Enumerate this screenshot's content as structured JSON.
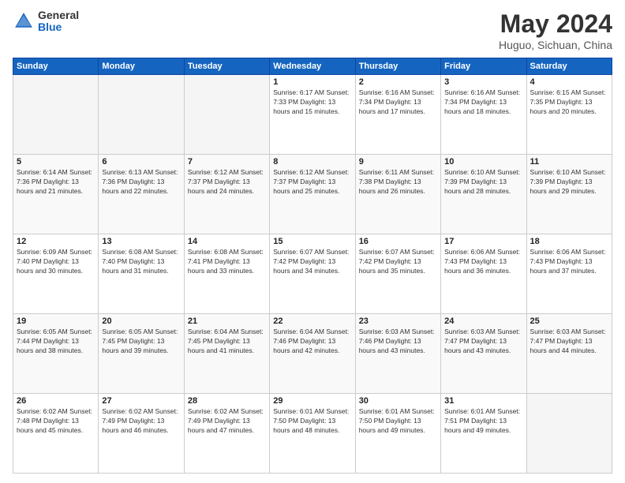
{
  "header": {
    "logo": {
      "general": "General",
      "blue": "Blue"
    },
    "title": "May 2024",
    "location": "Huguo, Sichuan, China"
  },
  "days_of_week": [
    "Sunday",
    "Monday",
    "Tuesday",
    "Wednesday",
    "Thursday",
    "Friday",
    "Saturday"
  ],
  "weeks": [
    [
      {
        "day": "",
        "info": ""
      },
      {
        "day": "",
        "info": ""
      },
      {
        "day": "",
        "info": ""
      },
      {
        "day": "1",
        "info": "Sunrise: 6:17 AM\nSunset: 7:33 PM\nDaylight: 13 hours\nand 15 minutes."
      },
      {
        "day": "2",
        "info": "Sunrise: 6:16 AM\nSunset: 7:34 PM\nDaylight: 13 hours\nand 17 minutes."
      },
      {
        "day": "3",
        "info": "Sunrise: 6:16 AM\nSunset: 7:34 PM\nDaylight: 13 hours\nand 18 minutes."
      },
      {
        "day": "4",
        "info": "Sunrise: 6:15 AM\nSunset: 7:35 PM\nDaylight: 13 hours\nand 20 minutes."
      }
    ],
    [
      {
        "day": "5",
        "info": "Sunrise: 6:14 AM\nSunset: 7:36 PM\nDaylight: 13 hours\nand 21 minutes."
      },
      {
        "day": "6",
        "info": "Sunrise: 6:13 AM\nSunset: 7:36 PM\nDaylight: 13 hours\nand 22 minutes."
      },
      {
        "day": "7",
        "info": "Sunrise: 6:12 AM\nSunset: 7:37 PM\nDaylight: 13 hours\nand 24 minutes."
      },
      {
        "day": "8",
        "info": "Sunrise: 6:12 AM\nSunset: 7:37 PM\nDaylight: 13 hours\nand 25 minutes."
      },
      {
        "day": "9",
        "info": "Sunrise: 6:11 AM\nSunset: 7:38 PM\nDaylight: 13 hours\nand 26 minutes."
      },
      {
        "day": "10",
        "info": "Sunrise: 6:10 AM\nSunset: 7:39 PM\nDaylight: 13 hours\nand 28 minutes."
      },
      {
        "day": "11",
        "info": "Sunrise: 6:10 AM\nSunset: 7:39 PM\nDaylight: 13 hours\nand 29 minutes."
      }
    ],
    [
      {
        "day": "12",
        "info": "Sunrise: 6:09 AM\nSunset: 7:40 PM\nDaylight: 13 hours\nand 30 minutes."
      },
      {
        "day": "13",
        "info": "Sunrise: 6:08 AM\nSunset: 7:40 PM\nDaylight: 13 hours\nand 31 minutes."
      },
      {
        "day": "14",
        "info": "Sunrise: 6:08 AM\nSunset: 7:41 PM\nDaylight: 13 hours\nand 33 minutes."
      },
      {
        "day": "15",
        "info": "Sunrise: 6:07 AM\nSunset: 7:42 PM\nDaylight: 13 hours\nand 34 minutes."
      },
      {
        "day": "16",
        "info": "Sunrise: 6:07 AM\nSunset: 7:42 PM\nDaylight: 13 hours\nand 35 minutes."
      },
      {
        "day": "17",
        "info": "Sunrise: 6:06 AM\nSunset: 7:43 PM\nDaylight: 13 hours\nand 36 minutes."
      },
      {
        "day": "18",
        "info": "Sunrise: 6:06 AM\nSunset: 7:43 PM\nDaylight: 13 hours\nand 37 minutes."
      }
    ],
    [
      {
        "day": "19",
        "info": "Sunrise: 6:05 AM\nSunset: 7:44 PM\nDaylight: 13 hours\nand 38 minutes."
      },
      {
        "day": "20",
        "info": "Sunrise: 6:05 AM\nSunset: 7:45 PM\nDaylight: 13 hours\nand 39 minutes."
      },
      {
        "day": "21",
        "info": "Sunrise: 6:04 AM\nSunset: 7:45 PM\nDaylight: 13 hours\nand 41 minutes."
      },
      {
        "day": "22",
        "info": "Sunrise: 6:04 AM\nSunset: 7:46 PM\nDaylight: 13 hours\nand 42 minutes."
      },
      {
        "day": "23",
        "info": "Sunrise: 6:03 AM\nSunset: 7:46 PM\nDaylight: 13 hours\nand 43 minutes."
      },
      {
        "day": "24",
        "info": "Sunrise: 6:03 AM\nSunset: 7:47 PM\nDaylight: 13 hours\nand 43 minutes."
      },
      {
        "day": "25",
        "info": "Sunrise: 6:03 AM\nSunset: 7:47 PM\nDaylight: 13 hours\nand 44 minutes."
      }
    ],
    [
      {
        "day": "26",
        "info": "Sunrise: 6:02 AM\nSunset: 7:48 PM\nDaylight: 13 hours\nand 45 minutes."
      },
      {
        "day": "27",
        "info": "Sunrise: 6:02 AM\nSunset: 7:49 PM\nDaylight: 13 hours\nand 46 minutes."
      },
      {
        "day": "28",
        "info": "Sunrise: 6:02 AM\nSunset: 7:49 PM\nDaylight: 13 hours\nand 47 minutes."
      },
      {
        "day": "29",
        "info": "Sunrise: 6:01 AM\nSunset: 7:50 PM\nDaylight: 13 hours\nand 48 minutes."
      },
      {
        "day": "30",
        "info": "Sunrise: 6:01 AM\nSunset: 7:50 PM\nDaylight: 13 hours\nand 49 minutes."
      },
      {
        "day": "31",
        "info": "Sunrise: 6:01 AM\nSunset: 7:51 PM\nDaylight: 13 hours\nand 49 minutes."
      },
      {
        "day": "",
        "info": ""
      }
    ]
  ]
}
